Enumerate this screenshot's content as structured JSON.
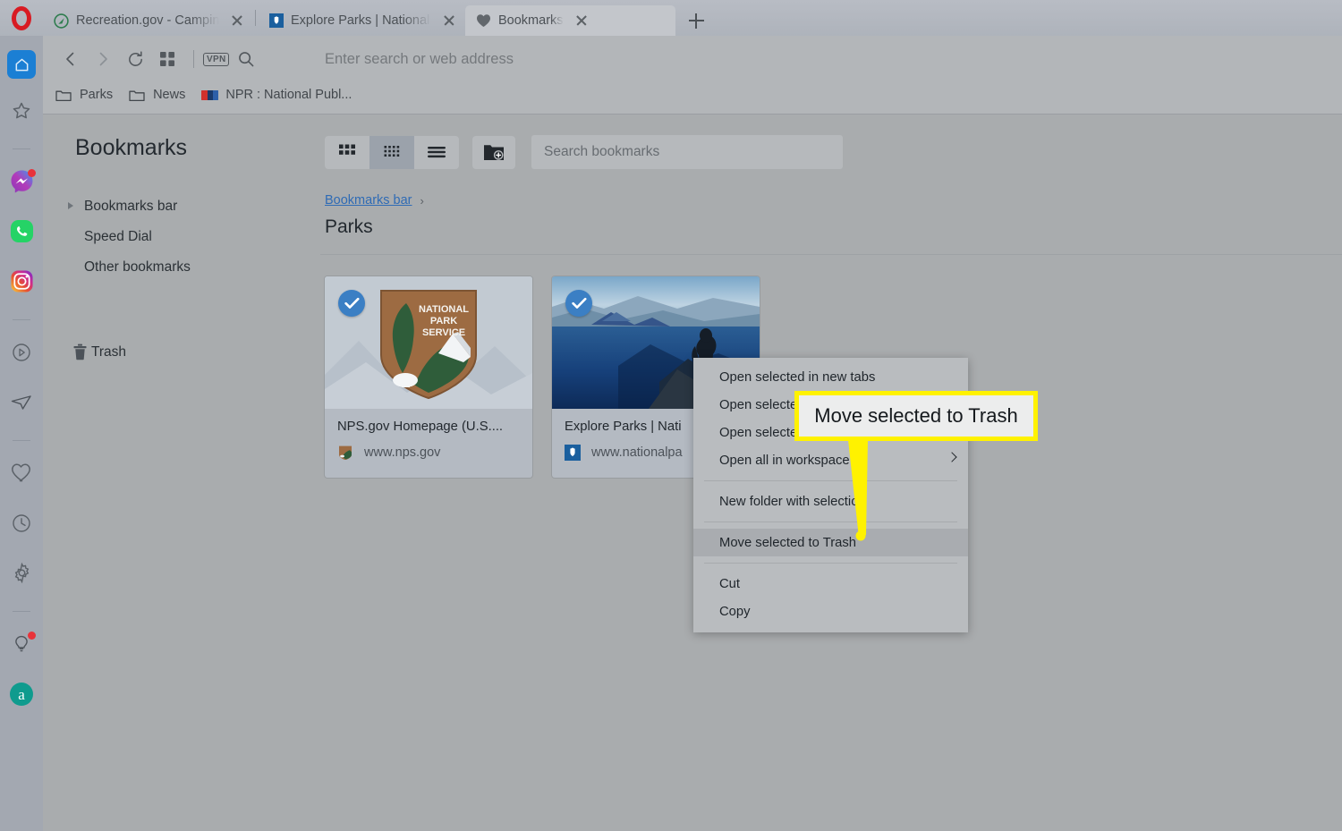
{
  "browser": {
    "name": "Opera",
    "tabs": [
      {
        "title": "Recreation.gov - Camping,",
        "favicon": "recreation-gov-icon",
        "active": false
      },
      {
        "title": "Explore Parks | National Par",
        "favicon": "nps-shield-icon",
        "active": false
      },
      {
        "title": "Bookmarks",
        "favicon": "heart-icon",
        "active": true
      }
    ],
    "new_tab_label": "+",
    "nav": {
      "back": "‹",
      "forward": "›",
      "reload": "↻",
      "tiles": "workspaces-icon",
      "vpn_label": "VPN",
      "search_icon": "search-icon",
      "address_placeholder": "Enter search or web address",
      "address_value": ""
    },
    "bookmarks_bar": [
      {
        "label": "Parks",
        "icon": "folder-icon"
      },
      {
        "label": "News",
        "icon": "folder-icon"
      },
      {
        "label": "NPR : National Publ...",
        "icon": "npr-icon"
      }
    ]
  },
  "rail": {
    "items": [
      {
        "name": "home",
        "icon": "home-icon",
        "selected": true,
        "badge": false
      },
      {
        "name": "favorites",
        "icon": "star-icon",
        "selected": false,
        "badge": false
      },
      {
        "name": "messenger",
        "icon": "messenger-icon",
        "selected": false,
        "badge": true
      },
      {
        "name": "whatsapp",
        "icon": "whatsapp-icon",
        "selected": false,
        "badge": false
      },
      {
        "name": "instagram",
        "icon": "instagram-icon",
        "selected": false,
        "badge": false
      },
      {
        "name": "player",
        "icon": "play-circle-icon",
        "selected": false,
        "badge": false
      },
      {
        "name": "telegram",
        "icon": "telegram-icon",
        "selected": false,
        "badge": false
      },
      {
        "name": "bookmarks",
        "icon": "heart-icon",
        "selected": false,
        "badge": false
      },
      {
        "name": "history",
        "icon": "clock-icon",
        "selected": false,
        "badge": false
      },
      {
        "name": "settings",
        "icon": "gear-icon",
        "selected": false,
        "badge": false
      },
      {
        "name": "tips",
        "icon": "lightbulb-icon",
        "selected": false,
        "badge": true
      },
      {
        "name": "amazon",
        "icon": "amazon-icon",
        "selected": false,
        "badge": false
      }
    ]
  },
  "bookmarks_page": {
    "heading": "Bookmarks",
    "tree": [
      {
        "label": "Bookmarks bar",
        "expandable": true
      },
      {
        "label": "Speed Dial",
        "expandable": false
      },
      {
        "label": "Other bookmarks",
        "expandable": false
      }
    ],
    "trash_label": "Trash",
    "view_modes": [
      {
        "name": "large-grid",
        "selected": false
      },
      {
        "name": "small-grid",
        "selected": true
      },
      {
        "name": "list",
        "selected": false
      }
    ],
    "new_folder_label": "new-folder-icon",
    "search": {
      "placeholder": "Search bookmarks",
      "value": ""
    },
    "breadcrumb": {
      "parent": "Bookmarks bar",
      "separator": "›"
    },
    "folder_title": "Parks",
    "cards": [
      {
        "title": "NPS.gov Homepage (U.S....",
        "url": "www.nps.gov",
        "thumb": "nps-arrowhead-thumb",
        "favicon": "nps-arrowhead-icon",
        "selected": true
      },
      {
        "title": "Explore Parks | Nati",
        "url": "www.nationalpa",
        "thumb": "crater-lake-photo-thumb",
        "favicon": "nps-shield-icon",
        "selected": true
      }
    ]
  },
  "context_menu": {
    "items": [
      {
        "label": "Open selected in new tabs",
        "type": "item",
        "highlighted": false,
        "submenu": false
      },
      {
        "label": "Open selected in new window",
        "type": "item",
        "highlighted": false,
        "submenu": false
      },
      {
        "label": "Open selected in private window",
        "type": "item",
        "highlighted": false,
        "submenu": false
      },
      {
        "label": "Open all in workspace",
        "type": "item",
        "highlighted": false,
        "submenu": true
      },
      {
        "type": "separator"
      },
      {
        "label": "New folder with selection",
        "type": "item",
        "highlighted": false,
        "submenu": false
      },
      {
        "type": "separator"
      },
      {
        "label": "Move selected to Trash",
        "type": "item",
        "highlighted": true,
        "submenu": false
      },
      {
        "type": "separator"
      },
      {
        "label": "Cut",
        "type": "item",
        "highlighted": false,
        "submenu": false
      },
      {
        "label": "Copy",
        "type": "item",
        "highlighted": false,
        "submenu": false
      }
    ]
  },
  "callout": {
    "text": "Move selected to Trash",
    "border_color": "#fff200",
    "fill_color": "#eceded"
  },
  "colors": {
    "tab_bar": "#b3b7bf",
    "rail": "#a3a8b1",
    "chrome": "#b3b6b9",
    "page_bg": "#a9acae",
    "card_bg": "#b4bac2",
    "accent_blue": "#3b7fc4",
    "link_blue": "#2f6bb5",
    "menu_bg": "#b9bcbf",
    "menu_highlight": "#a9acb0",
    "badge_red": "#e8333a",
    "opera_red": "#d81b23",
    "highlight_yellow": "#fff200"
  }
}
